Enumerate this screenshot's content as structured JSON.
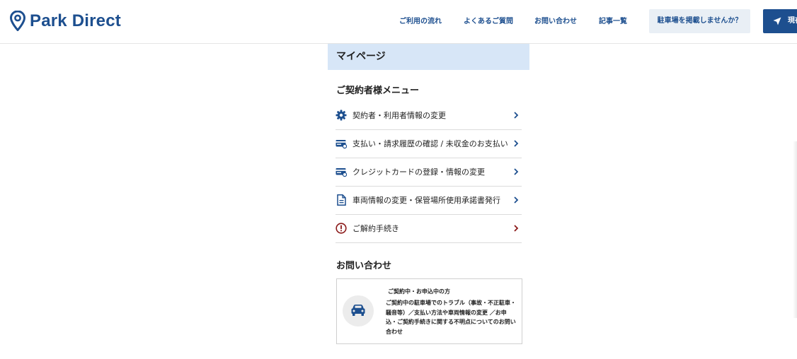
{
  "header": {
    "logo_text": "Park Direct",
    "nav": [
      {
        "label": "ご利用の流れ"
      },
      {
        "label": "よくあるご質問"
      },
      {
        "label": "お問い合わせ"
      },
      {
        "label": "記事一覧"
      }
    ],
    "post_button": "駐車場を掲載しませんか？",
    "cta_button": "現在"
  },
  "mypage": {
    "title": "マイページ"
  },
  "contract_menu": {
    "title": "ご契約者様メニュー",
    "items": [
      {
        "label": "契約者・利用者情報の変更",
        "icon": "gear-icon"
      },
      {
        "label": "支払い・請求履歴の確認 / 未収金のお支払い",
        "icon": "card-icon"
      },
      {
        "label": "クレジットカードの登録・情報の変更",
        "icon": "card-icon"
      },
      {
        "label": "車両情報の変更・保管場所使用承諾書発行",
        "icon": "document-icon"
      },
      {
        "label": "ご解約手続き",
        "icon": "alert-icon"
      }
    ]
  },
  "contact": {
    "title": "お問い合わせ",
    "card_title": "ご契約中・お申込中の方",
    "card_body": "ご契約中の駐車場でのトラブル（事故・不正駐車・騒音等）／支払い方法や車両情報の変更 ／お申込・ご契約手続きに関する不明点についてのお問い合わせ",
    "icon": "car-icon"
  },
  "colors": {
    "brand": "#1d4f8f",
    "mypage_bar": "#d7e6f7",
    "alert": "#8b1a1a"
  }
}
